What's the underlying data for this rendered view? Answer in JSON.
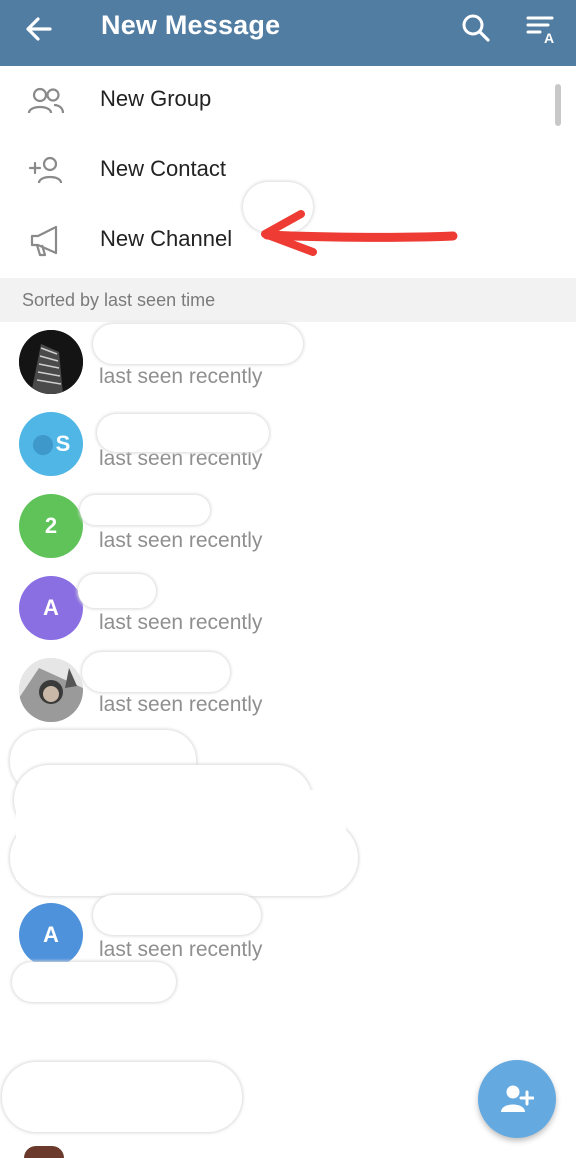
{
  "header": {
    "title": "New Message",
    "back_icon": "arrow-left-icon",
    "search_icon": "search-icon",
    "sort_icon": "sort-by-name-icon",
    "background": "#527da3"
  },
  "menu": [
    {
      "label": "New Group",
      "icon": "group-icon"
    },
    {
      "label": "New Contact",
      "icon": "add-contact-icon"
    },
    {
      "label": "New Channel",
      "icon": "megaphone-icon"
    }
  ],
  "annotation": {
    "arrow_color": "#ee3b33",
    "points_to": "New Channel"
  },
  "section": {
    "label": "Sorted by last seen time"
  },
  "contacts": [
    {
      "avatar_letter": "",
      "avatar_type": "photo",
      "status": "last seen recently"
    },
    {
      "avatar_letter": "S",
      "avatar_color": "#4fb6e6",
      "status": "last seen recently"
    },
    {
      "avatar_letter": "2",
      "avatar_color": "#5fc35a",
      "status": "last seen recently"
    },
    {
      "avatar_letter": "A",
      "avatar_color": "#8a6fe3",
      "status": "last seen recently"
    },
    {
      "avatar_letter": "",
      "avatar_type": "photo",
      "status": "last seen recently"
    },
    {
      "avatar_letter": "A",
      "avatar_color": "#4f92dc",
      "status": "last seen recently"
    }
  ],
  "fab": {
    "icon": "add-person-icon",
    "color": "#64a9df"
  }
}
